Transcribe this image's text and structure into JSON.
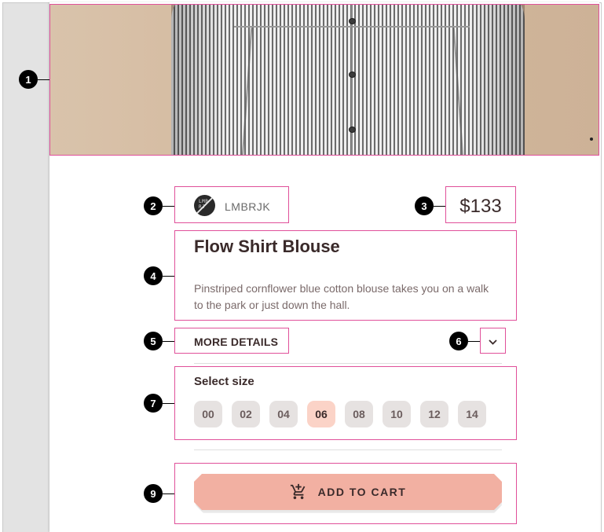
{
  "product": {
    "brand": "LMBRJK",
    "brand_logo_text": "LMB RJ",
    "price": "$133",
    "title": "Flow Shirt Blouse",
    "description": "Pinstriped cornflower blue cotton blouse takes you on a walk to the park or just down the hall."
  },
  "details": {
    "more_label": "MORE DETAILS",
    "expand_icon": "chevron-down-icon"
  },
  "sizes": {
    "label": "Select size",
    "options": [
      "00",
      "02",
      "04",
      "06",
      "08",
      "10",
      "12",
      "14"
    ],
    "selected": "06"
  },
  "cart": {
    "label": "ADD TO CART",
    "icon": "add-shopping-cart-icon"
  },
  "annotations": [
    "1",
    "2",
    "3",
    "4",
    "5",
    "6",
    "7",
    "9"
  ],
  "colors": {
    "accent": "#f2b0a2",
    "selected_chip": "#fbd3c7",
    "chip": "#e6e2e1",
    "annotation": "#e0509a"
  }
}
